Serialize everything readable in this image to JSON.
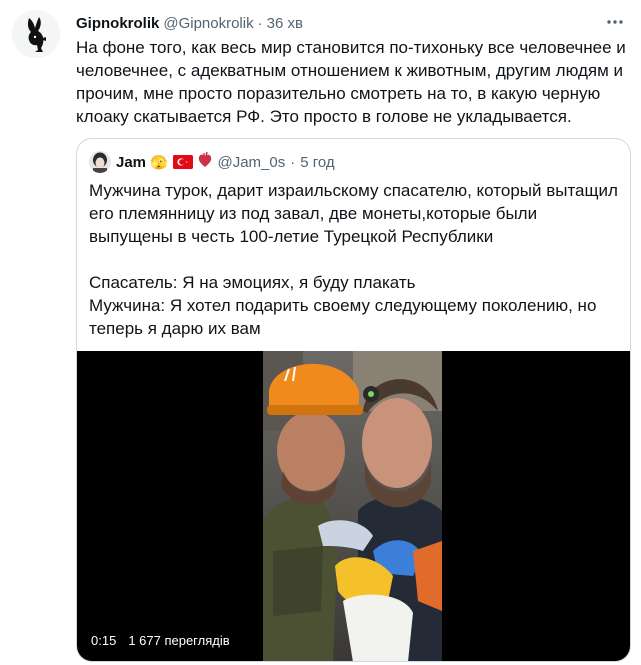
{
  "tweet": {
    "author_name": "Gipnokrolik",
    "author_handle": "@Gipnokrolik",
    "separator": "·",
    "time": "36 хв",
    "more_icon": "more-horizontal-icon",
    "text": "На фоне того, как весь мир становится по-тихоньку все человечнее и человечнее, с адекватным отношением к животным, другим людям и прочим, мне просто поразительно смотреть на то, в какую черную клоаку скатывается РФ. Это просто в голове не укладывается."
  },
  "quote": {
    "author_name": "Jam",
    "author_emoji": "🫣",
    "flag_icon": "turkey-flag-icon",
    "heart_icon": "anatomical-heart-icon",
    "author_handle": "@Jam_0s",
    "separator": "·",
    "time": "5 год",
    "paragraphs": [
      "Мужчина турок, дарит израильскому спасателю, который вытащил его племянницу из под завал, две монеты,которые были выпущены в честь 100-летие Турецкой Республики",
      "Спасатель: Я на эмоциях, я буду плакать",
      "Мужчина: Я хотел подарить своему следующему поколению, но теперь я дарю их вам"
    ],
    "video": {
      "duration": "0:15",
      "views": "1 677 переглядів"
    }
  },
  "colors": {
    "text": "#0f1419",
    "secondary": "#536471",
    "border": "#cfd9de",
    "flag_red": "#e30a17",
    "helmet_orange": "#f08a1c"
  }
}
